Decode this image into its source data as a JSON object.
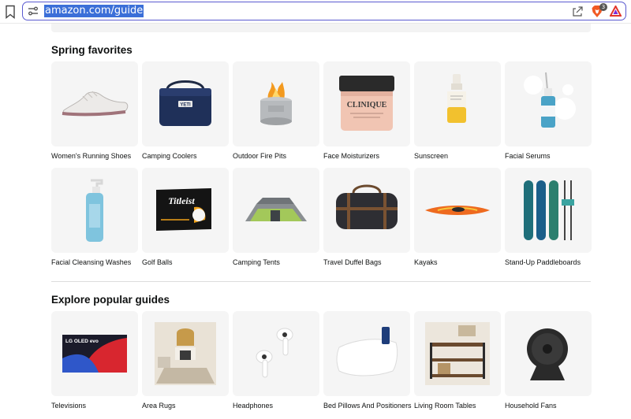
{
  "browser": {
    "url": "amazon.com/guide",
    "badge_count": "3"
  },
  "sections": [
    {
      "title": "Spring favorites",
      "items": [
        {
          "label": "Women's Running Shoes",
          "icon": "running-shoe"
        },
        {
          "label": "Camping Coolers",
          "icon": "cooler"
        },
        {
          "label": "Outdoor Fire Pits",
          "icon": "fire-pit"
        },
        {
          "label": "Face Moisturizers",
          "icon": "moisturizer-jar"
        },
        {
          "label": "Sunscreen",
          "icon": "sunscreen-bottle"
        },
        {
          "label": "Facial Serums",
          "icon": "serum-bottle"
        },
        {
          "label": "Facial Cleansing Washes",
          "icon": "cleanser-pump"
        },
        {
          "label": "Golf Balls",
          "icon": "golf-ball-box"
        },
        {
          "label": "Camping Tents",
          "icon": "tent"
        },
        {
          "label": "Travel Duffel Bags",
          "icon": "duffel-bag"
        },
        {
          "label": "Kayaks",
          "icon": "kayak"
        },
        {
          "label": "Stand-Up Paddleboards",
          "icon": "paddleboard"
        }
      ]
    },
    {
      "title": "Explore popular guides",
      "items": [
        {
          "label": "Televisions",
          "icon": "television"
        },
        {
          "label": "Area Rugs",
          "icon": "area-rug-room"
        },
        {
          "label": "Headphones",
          "icon": "earbuds"
        },
        {
          "label": "Bed Pillows And Positioners",
          "icon": "pillow"
        },
        {
          "label": "Living Room Tables",
          "icon": "console-table"
        },
        {
          "label": "Household Fans",
          "icon": "fan"
        }
      ]
    }
  ],
  "product_text": {
    "cooler_brand": "YETI",
    "moisturizer_brand": "CLINIQUE",
    "golf_brand": "Titleist",
    "tv_brand": "LG OLED evo"
  },
  "colors": {
    "accent_selection": "#3b6fd8",
    "url_border": "#5a5ad0",
    "tile_bg": "#f5f5f5"
  }
}
